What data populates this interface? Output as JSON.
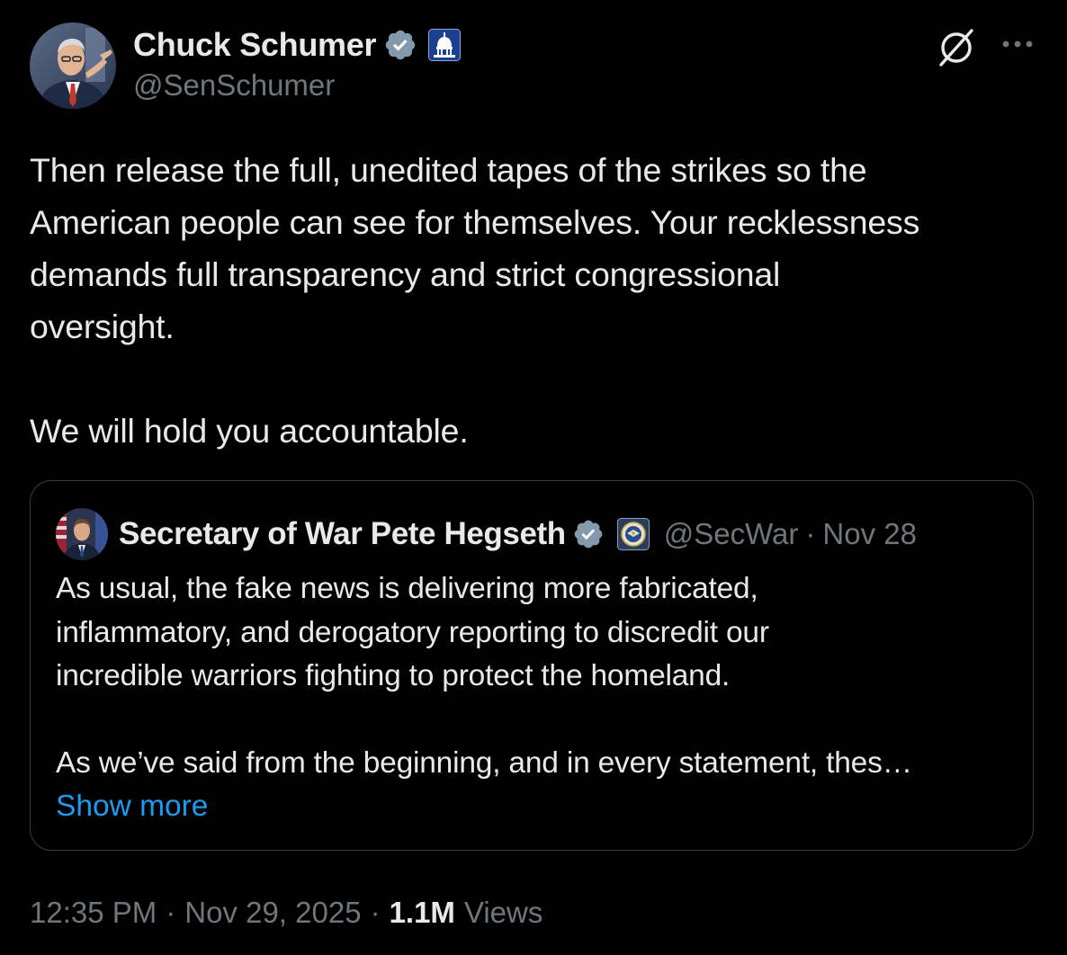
{
  "author": {
    "display_name": "Chuck Schumer",
    "handle": "@SenSchumer",
    "avatar": "senator-portrait",
    "verified_icon": "verified-badge-icon",
    "affiliation_icon": "capitol-dome-icon"
  },
  "actions": {
    "grok_icon": "grok-icon",
    "more_icon": "more-options-icon"
  },
  "tweet": {
    "text": "Then release the full, unedited tapes of the strikes so the\nAmerican people can see for themselves. Your recklessness\ndemands full transparency and strict congressional\noversight.\n\nWe will hold you accountable."
  },
  "quoted": {
    "display_name": "Secretary of War Pete Hegseth",
    "handle": "@SecWar",
    "separator": "·",
    "date": "Nov 28",
    "avatar": "secretary-portrait",
    "affiliation_icon": "department-seal-icon",
    "text": "As usual, the fake news is delivering more fabricated,\ninflammatory, and derogatory reporting to discredit our\nincredible warriors fighting to protect the homeland.\n\nAs we’ve said from the beginning, and in every statement, thes…",
    "show_more": "Show more"
  },
  "meta": {
    "time": "12:35 PM",
    "separator": "·",
    "date": "Nov 29, 2025",
    "separator2": "·",
    "views_count": "1.1M",
    "views_label": "Views"
  },
  "colors": {
    "background": "#000000",
    "text_primary": "#e7e9ea",
    "text_secondary": "#71767b",
    "link": "#1d9bf0",
    "border": "#3a3d40",
    "verified_badge": "#829aab"
  }
}
